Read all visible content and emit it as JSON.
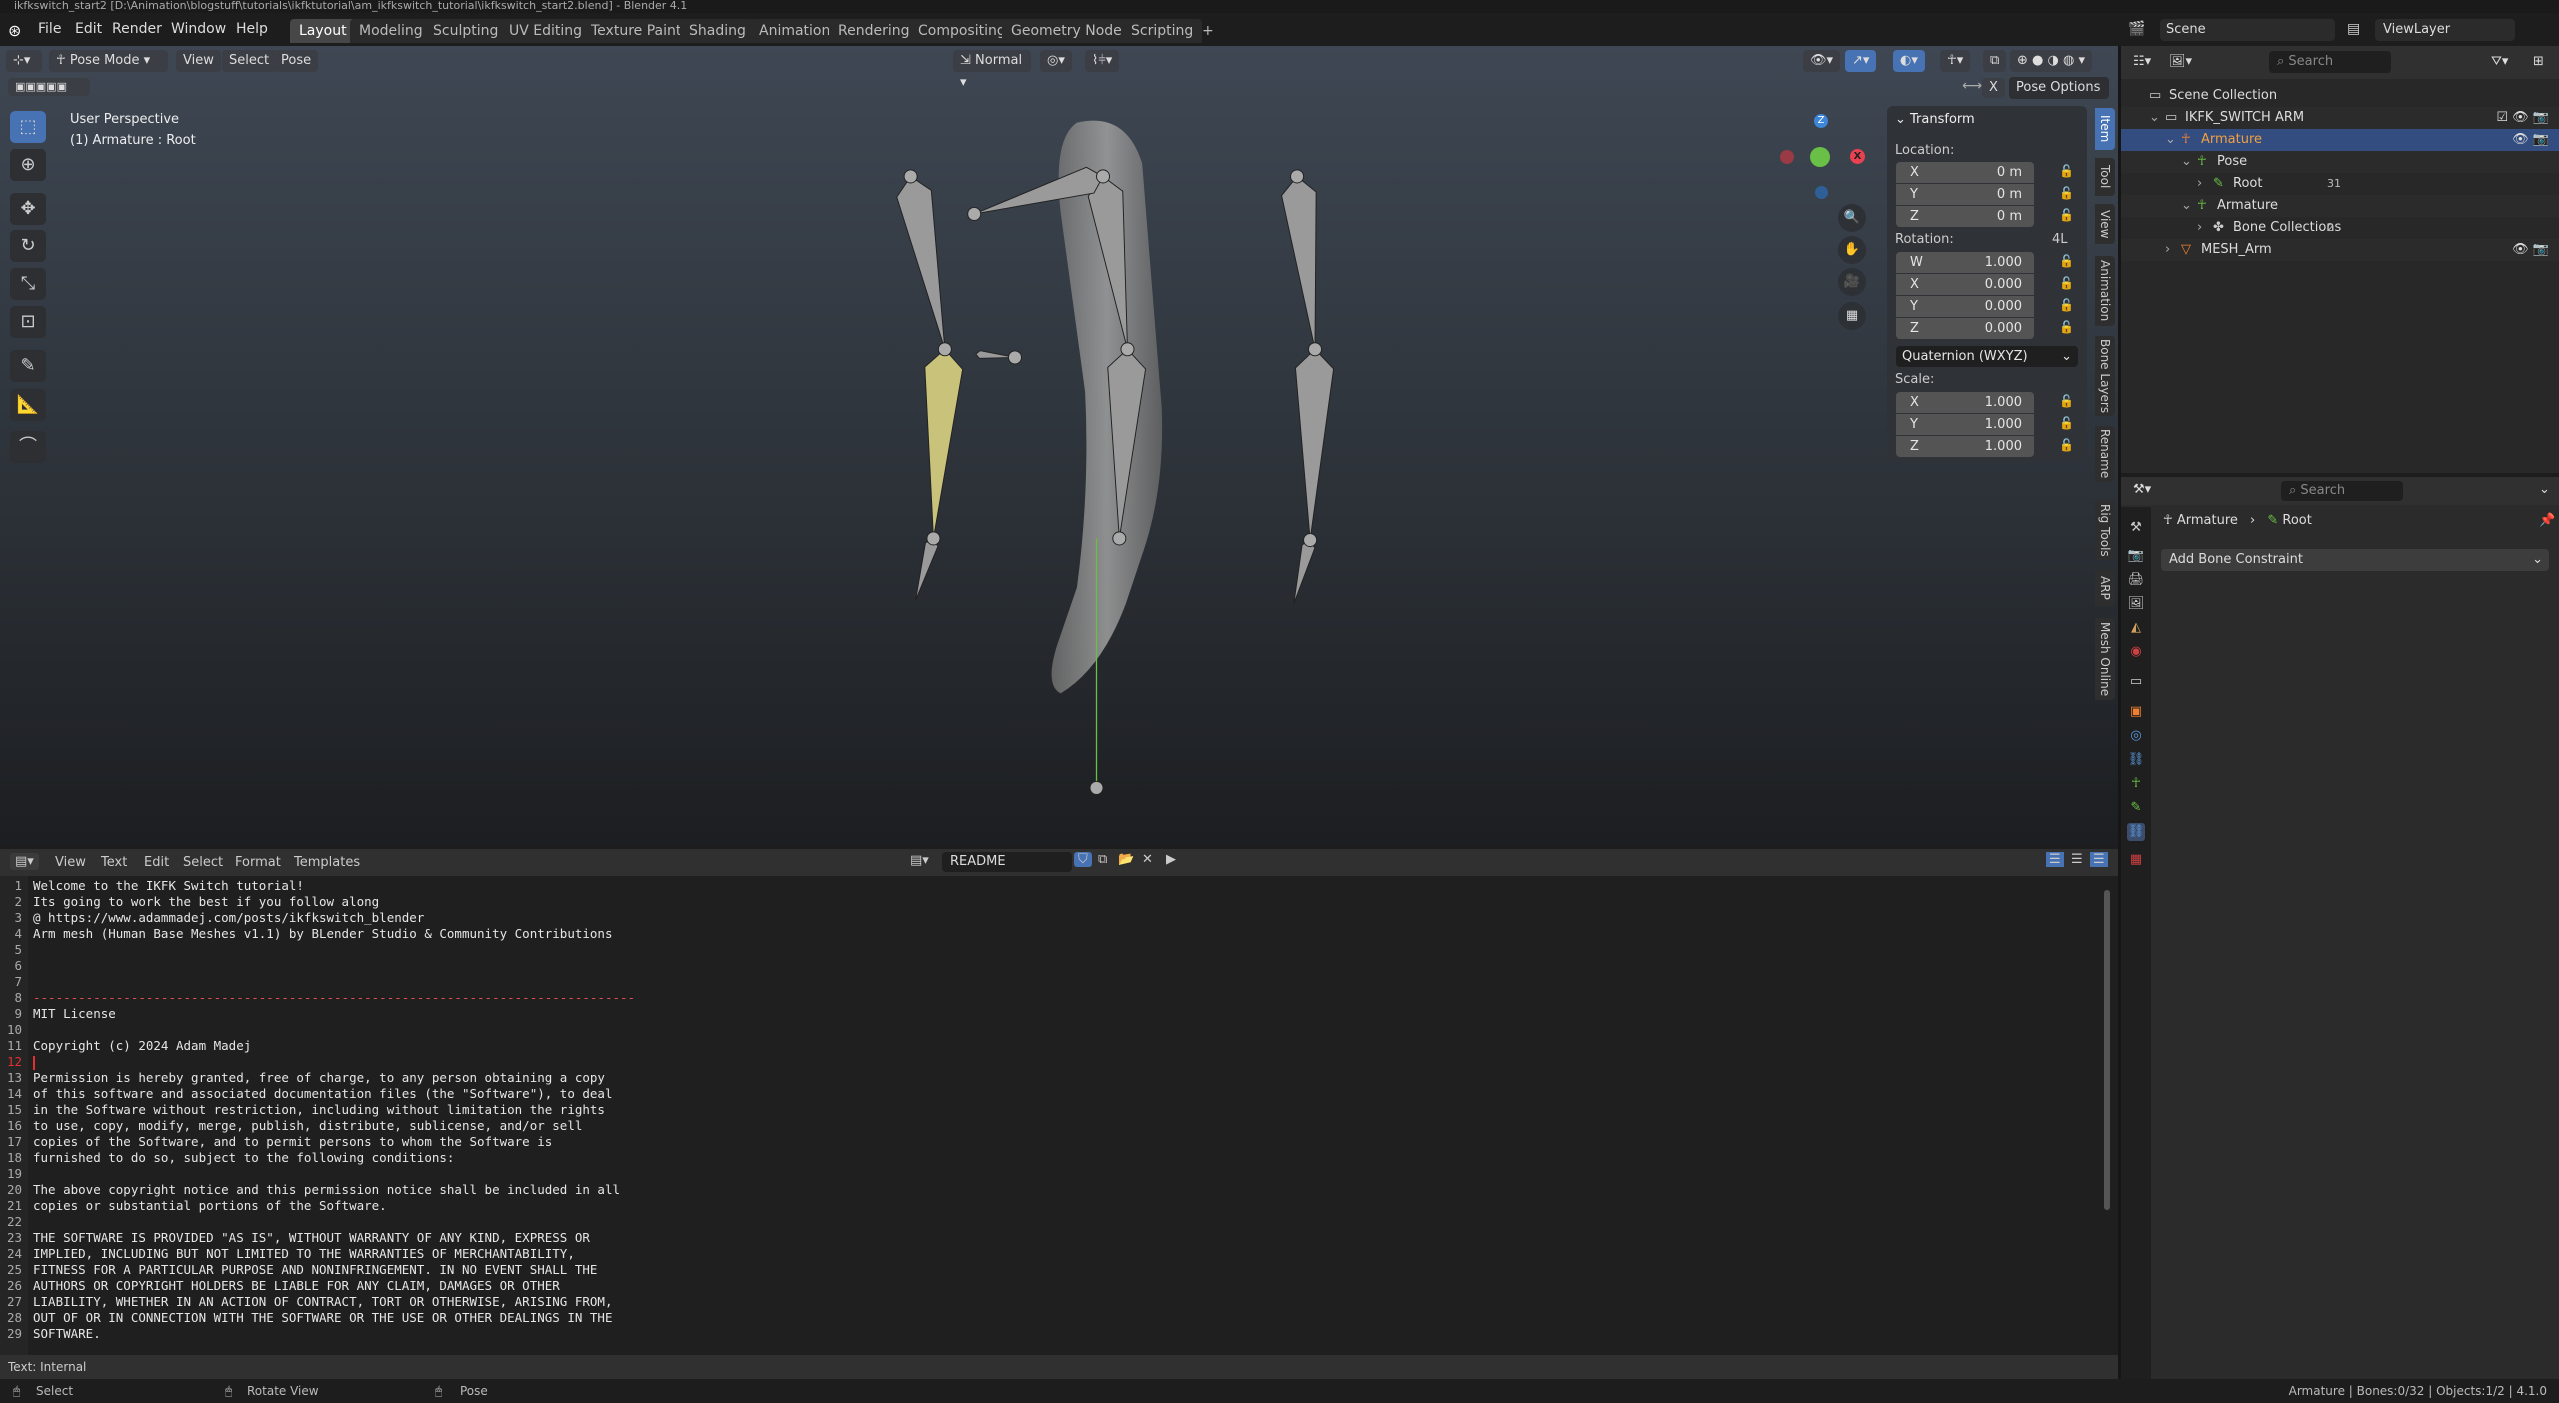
{
  "window_title": "ikfkswitch_start2 [D:\\Animation\\blogstuff\\tutorials\\ikfktutorial\\am_ikfkswitch_tutorial\\ikfkswitch_start2.blend] - Blender 4.1",
  "menu": [
    "File",
    "Edit",
    "Render",
    "Window",
    "Help"
  ],
  "workspaces": [
    "Layout",
    "Modeling",
    "Sculpting",
    "UV Editing",
    "Texture Paint",
    "Shading",
    "Animation",
    "Rendering",
    "Compositing",
    "Geometry Nodes",
    "Scripting",
    "+"
  ],
  "active_workspace": "Layout",
  "scene": {
    "name": "Scene",
    "view_layer": "ViewLayer"
  },
  "viewport": {
    "mode": "Pose Mode",
    "menus": [
      "View",
      "Select",
      "Pose"
    ],
    "orientation": "Normal",
    "pose_options": "Pose Options",
    "x_mirror": "X",
    "info_line1": "User Perspective",
    "info_line2": "(1) Armature : Root",
    "gizmo": {
      "x": "X",
      "y": "Y",
      "z": "Z"
    },
    "tools": [
      "select-box",
      "cursor",
      "move",
      "rotate",
      "scale",
      "transform",
      "annotate",
      "measure",
      "relax-pose"
    ],
    "colors": {
      "x_axis": "#e8414f",
      "y_axis": "#6ac046",
      "z_axis": "#3d86d8",
      "selected_bone": "#c9c27a"
    }
  },
  "transform_panel": {
    "title": "Transform",
    "location_label": "Location:",
    "location": [
      {
        "axis": "X",
        "value": "0 m"
      },
      {
        "axis": "Y",
        "value": "0 m"
      },
      {
        "axis": "Z",
        "value": "0 m"
      }
    ],
    "rotation_label": "Rotation:",
    "rotation_mode_badge": "4L",
    "rotation": [
      {
        "axis": "W",
        "value": "1.000"
      },
      {
        "axis": "X",
        "value": "0.000"
      },
      {
        "axis": "Y",
        "value": "0.000"
      },
      {
        "axis": "Z",
        "value": "0.000"
      }
    ],
    "rotation_mode": "Quaternion (WXYZ)",
    "scale_label": "Scale:",
    "scale": [
      {
        "axis": "X",
        "value": "1.000"
      },
      {
        "axis": "Y",
        "value": "1.000"
      },
      {
        "axis": "Z",
        "value": "1.000"
      }
    ]
  },
  "sidebar_tabs": [
    "Item",
    "Tool",
    "View",
    "Animation",
    "Bone Layers",
    "Rename",
    "Rig Tools",
    "ARP",
    "Mesh Online"
  ],
  "text_editor": {
    "menus": [
      "View",
      "Text",
      "Edit",
      "Select",
      "Format",
      "Templates"
    ],
    "file_name": "README",
    "footer": "Text: Internal",
    "current_line": 12,
    "lines": [
      "Welcome to the IKFK Switch tutorial!",
      "Its going to work the best if you follow along",
      "@ https://www.adammadej.com/posts/ikfkswitch_blender",
      "Arm mesh (Human Base Meshes v1.1) by BLender Studio & Community Contributions",
      "",
      "",
      "",
      "--------------------------------------------------------------------------------",
      "MIT License",
      "",
      "Copyright (c) 2024 Adam Madej",
      "",
      "Permission is hereby granted, free of charge, to any person obtaining a copy",
      "of this software and associated documentation files (the \"Software\"), to deal",
      "in the Software without restriction, including without limitation the rights",
      "to use, copy, modify, merge, publish, distribute, sublicense, and/or sell",
      "copies of the Software, and to permit persons to whom the Software is",
      "furnished to do so, subject to the following conditions:",
      "",
      "The above copyright notice and this permission notice shall be included in all",
      "copies or substantial portions of the Software.",
      "",
      "THE SOFTWARE IS PROVIDED \"AS IS\", WITHOUT WARRANTY OF ANY KIND, EXPRESS OR",
      "IMPLIED, INCLUDING BUT NOT LIMITED TO THE WARRANTIES OF MERCHANTABILITY,",
      "FITNESS FOR A PARTICULAR PURPOSE AND NONINFRINGEMENT. IN NO EVENT SHALL THE",
      "AUTHORS OR COPYRIGHT HOLDERS BE LIABLE FOR ANY CLAIM, DAMAGES OR OTHER",
      "LIABILITY, WHETHER IN AN ACTION OF CONTRACT, TORT OR OTHERWISE, ARISING FROM,",
      "OUT OF OR IN CONNECTION WITH THE SOFTWARE OR THE USE OR OTHER DEALINGS IN THE",
      "SOFTWARE."
    ]
  },
  "outliner": {
    "search_placeholder": "Search",
    "rows": [
      {
        "label": "Scene Collection",
        "icon": "collection-icon"
      },
      {
        "label": "IKFK_SWITCH ARM",
        "icon": "collection-icon"
      },
      {
        "label": "Armature",
        "icon": "armature-object-icon",
        "selected": true
      },
      {
        "label": "Pose",
        "icon": "pose-icon"
      },
      {
        "label": "Root",
        "icon": "bone-icon",
        "badge": "31"
      },
      {
        "label": "Armature",
        "icon": "armature-data-icon"
      },
      {
        "label": "Bone Collections",
        "icon": "bone-collections-icon",
        "badge": "2"
      },
      {
        "label": "MESH_Arm",
        "icon": "mesh-icon"
      }
    ]
  },
  "properties": {
    "search_placeholder": "Search",
    "breadcrumb": [
      "Armature",
      "Root"
    ],
    "add_constraint": "Add Bone Constraint"
  },
  "statusbar": {
    "hints": [
      "Select",
      "Rotate View",
      "Pose"
    ],
    "stats": "Armature | Bones:0/32 | Objects:1/2 | 4.1.0"
  }
}
